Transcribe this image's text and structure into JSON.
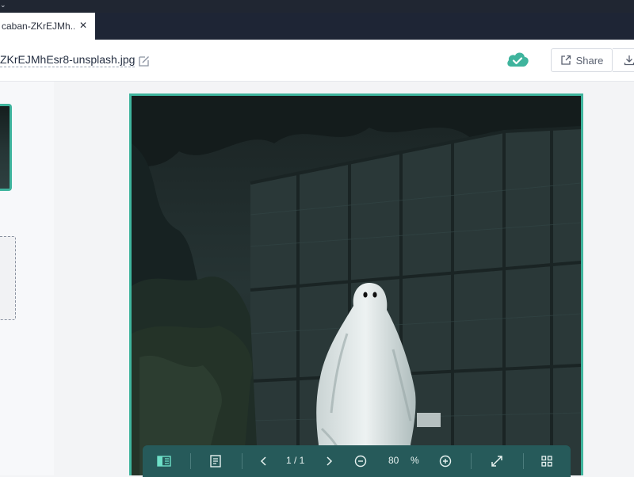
{
  "tabs": {
    "active_tab_label": "caban-ZKrEJMh...",
    "close_glyph": "✕"
  },
  "header": {
    "file_name": "ZKrEJMhEsr8-unsplash.jpg",
    "share_label": "Share",
    "cloud_status": "saved-to-cloud"
  },
  "toolbar": {
    "page_indicator": "1 / 1",
    "zoom_value": "80",
    "zoom_unit": "%"
  },
  "colors": {
    "accent": "#3fb49d",
    "toolbar_bg": "#265a5a",
    "tabstrip_bg": "#1e2535"
  },
  "icons": {
    "sidebar_toggle": "sidebar-toggle-icon",
    "page_view": "document-icon",
    "prev": "chevron-left-icon",
    "next": "chevron-right-icon",
    "zoom_out": "zoom-out-icon",
    "zoom_in": "zoom-in-icon",
    "fit": "expand-icon",
    "grid": "grid-icon"
  }
}
